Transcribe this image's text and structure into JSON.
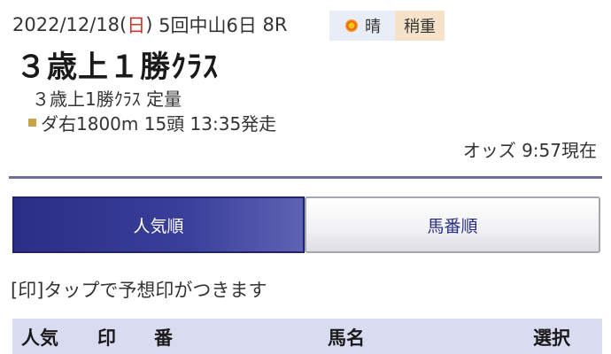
{
  "race_info": {
    "date_prefix": "2022/12/18(",
    "day": "日",
    "date_suffix": ")",
    "meeting": "5回中山6日",
    "race_number": "8R",
    "weather": "晴",
    "track_condition": "稍重",
    "title": "３歳上１勝ｸﾗｽ",
    "conditions": "３歳上1勝ｸﾗｽ 定量",
    "course": "ダ右1800m 15頭 13:35発走",
    "odds_time": "オッズ 9:57現在"
  },
  "icons": {
    "weather_icon": "sun-icon",
    "course_marker": "square-icon"
  },
  "tabs": [
    {
      "label": "人気順",
      "active": true
    },
    {
      "label": "馬番順",
      "active": false
    }
  ],
  "note": "[印]タップで予想印がつきます",
  "table": {
    "headers": {
      "rank": "人気",
      "mark": "印",
      "number": "番",
      "horse_name": "馬名",
      "select": "選択"
    }
  },
  "colors": {
    "accent": "#2a2e86",
    "divider": "#6d6e9c",
    "sunday_red": "#d0342c",
    "table_header_bg": "#d9dcf1",
    "weather_bg": "#e9edf7",
    "track_bg": "#f5e2c8"
  }
}
